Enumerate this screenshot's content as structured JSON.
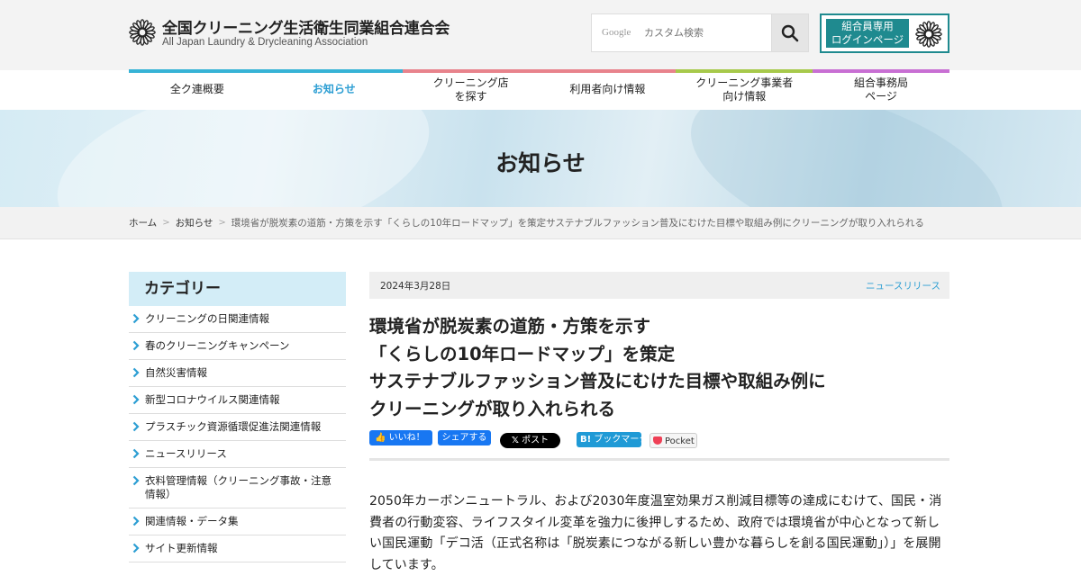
{
  "header": {
    "org_title": "全国クリーニング生活衛生同業組合連合会",
    "org_subtitle": "All Japan Laundry & Drycleaning Association",
    "search": {
      "google_label": "Google",
      "placeholder": "カスタム検索"
    },
    "login": {
      "line1": "組合員専用",
      "line2": "ログインページ"
    }
  },
  "nav": {
    "items": [
      {
        "label": "全ク連概要",
        "color": "#37b3d6"
      },
      {
        "label": "お知らせ",
        "color": "#37b3d6",
        "active": true
      },
      {
        "label": "クリーニング店\nを探す",
        "color": "#e8838c"
      },
      {
        "label": "利用者向け情報",
        "color": "#e8838c"
      },
      {
        "label": "クリーニング事業者\n向け情報",
        "color": "#a7c94b"
      },
      {
        "label": "組合事務局\nページ",
        "color": "#c86fd3"
      }
    ]
  },
  "hero": {
    "title": "お知らせ"
  },
  "breadcrumb": {
    "home": "ホーム",
    "section": "お知らせ",
    "current": "環境省が脱炭素の道筋・方策を示す「くらしの10年ロードマップ」を策定サステナブルファッション普及にむけた目標や取組み例にクリーニングが取り入れられる"
  },
  "sidebar": {
    "heading": "カテゴリー",
    "items": [
      "クリーニングの日関連情報",
      "春のクリーニングキャンペーン",
      "自然災害情報",
      "新型コロナウイルス関連情報",
      "プラスチック資源循環促進法関連情報",
      "ニュースリリース",
      "衣料管理情報（クリーニング事故・注意情報）",
      "関連情報・データ集",
      "サイト更新情報"
    ]
  },
  "article": {
    "date": "2024年3月28日",
    "category": "ニュースリリース",
    "title_lines": [
      "環境省が脱炭素の道筋・方策を示す",
      "「くらしの10年ロードマップ」を策定",
      "サステナブルファッション普及にむけた目標や取組み例に",
      "クリーニングが取り入れられる"
    ],
    "share": {
      "like": "いいね！",
      "share": "シェアする",
      "post": "ポスト",
      "bookmark": "ブックマーク",
      "pocket": "Pocket"
    },
    "body": "2050年カーボンニュートラル、および2030年度温室効果ガス削減目標等の達成にむけて、国民・消費者の行動変容、ライフスタイル変革を強力に後押しするため、政府では環境省が中心となって新しい国民運動「デコ活（正式名称は「脱炭素につながる新しい豊かな暮らしを創る国民運動」）」を展開しています。"
  },
  "colors": {
    "accent": "#2c9ed3",
    "login": "#1f8a8f",
    "sidebar_head": "#d3edf7"
  }
}
